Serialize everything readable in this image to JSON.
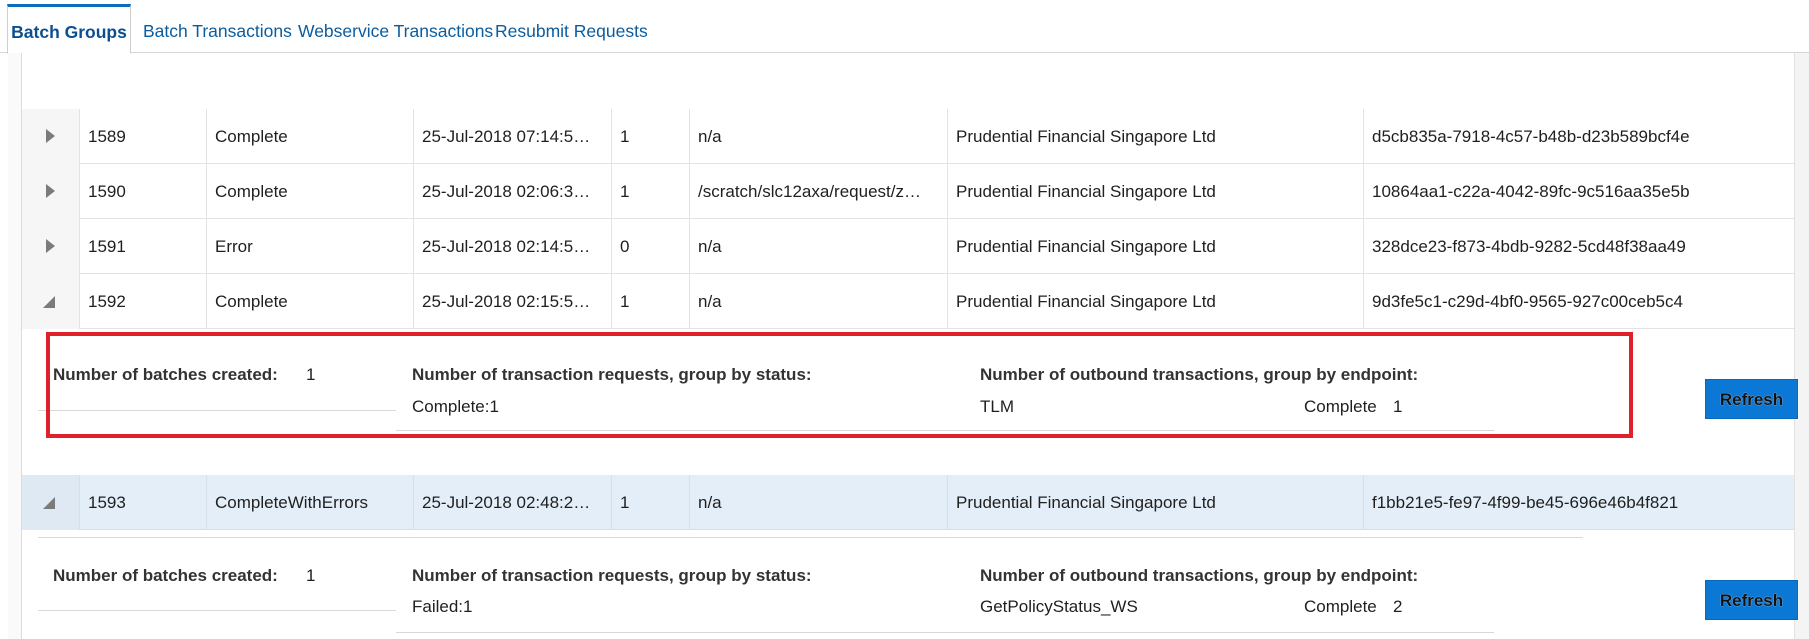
{
  "tabs": [
    {
      "label": "Batch Groups",
      "active": true
    },
    {
      "label": "Batch Transactions",
      "active": false
    },
    {
      "label": "Webservice Transactions",
      "active": false
    },
    {
      "label": "Resubmit Requests",
      "active": false
    }
  ],
  "rows": [
    {
      "id": "1589",
      "status": "Complete",
      "date": "25-Jul-2018 07:14:5…",
      "count": "1",
      "path": "n/a",
      "company": "Prudential Financial Singapore Ltd",
      "uuid": "d5cb835a-7918-4c57-b48b-d23b589bcf4e",
      "expanded": false
    },
    {
      "id": "1590",
      "status": "Complete",
      "date": "25-Jul-2018 02:06:3…",
      "count": "1",
      "path": "/scratch/slc12axa/request/z…",
      "company": "Prudential Financial Singapore Ltd",
      "uuid": "10864aa1-c22a-4042-89fc-9c516aa35e5b",
      "expanded": false
    },
    {
      "id": "1591",
      "status": "Error",
      "date": "25-Jul-2018 02:14:5…",
      "count": "0",
      "path": "n/a",
      "company": "Prudential Financial Singapore Ltd",
      "uuid": "328dce23-f873-4bdb-9282-5cd48f38aa49",
      "expanded": false
    },
    {
      "id": "1592",
      "status": "Complete",
      "date": "25-Jul-2018 02:15:5…",
      "count": "1",
      "path": "n/a",
      "company": "Prudential Financial Singapore Ltd",
      "uuid": "9d3fe5c1-c29d-4bf0-9565-927c00ceb5c4",
      "expanded": true
    },
    {
      "id": "1593",
      "status": "CompleteWithErrors",
      "date": "25-Jul-2018 02:48:2…",
      "count": "1",
      "path": "n/a",
      "company": "Prudential Financial Singapore Ltd",
      "uuid": "f1bb21e5-fe97-4f99-be45-696e46b4f821",
      "expanded": true
    }
  ],
  "details": [
    {
      "batches_label": "Number of batches created:",
      "batches_value": "1",
      "requests_label": "Number of transaction requests, group by status:",
      "requests_value": "Complete:1",
      "outbound_label": "Number of outbound transactions, group by endpoint:",
      "endpoint": "TLM",
      "endpoint_status": "Complete",
      "endpoint_count": "1",
      "refresh_label": "Refresh"
    },
    {
      "batches_label": "Number of batches created:",
      "batches_value": "1",
      "requests_label": "Number of transaction requests, group by status:",
      "requests_value": "Failed:1",
      "outbound_label": "Number of outbound transactions, group by endpoint:",
      "endpoint": "GetPolicyStatus_WS",
      "endpoint_status": "Complete",
      "endpoint_count": "2",
      "refresh_label": "Refresh"
    }
  ],
  "colors": {
    "accent": "#0b78d6",
    "highlight": "#e0202a",
    "selected_row": "#e3eef8"
  },
  "icons": {
    "collapsed": "triangle-right-icon",
    "expanded": "triangle-expanded-icon"
  }
}
